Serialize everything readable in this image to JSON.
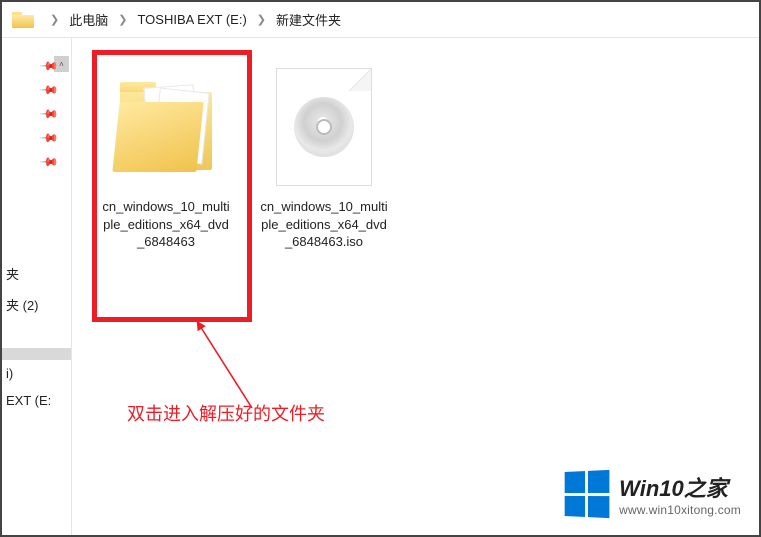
{
  "breadcrumb": {
    "item1": "此电脑",
    "item2": "TOSHIBA EXT (E:)",
    "item3": "新建文件夹"
  },
  "sidebar": {
    "item1": "夹",
    "item2": "夹 (2)",
    "item3": "i)",
    "item4": "EXT (E:"
  },
  "files": [
    {
      "name": "cn_windows_10_multiple_editions_x64_dvd_6848463",
      "type": "folder"
    },
    {
      "name": "cn_windows_10_multiple_editions_x64_dvd_6848463.iso",
      "type": "iso"
    }
  ],
  "annotation": "双击进入解压好的文件夹",
  "watermark": {
    "title": "Win10之家",
    "url": "www.win10xitong.com"
  }
}
